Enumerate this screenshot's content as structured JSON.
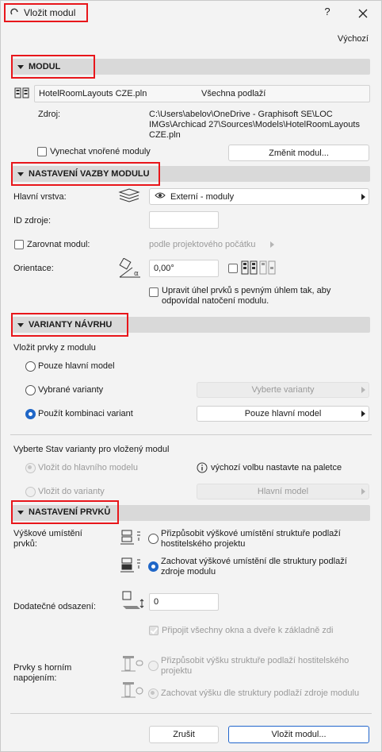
{
  "window": {
    "title": "Vložit modul",
    "help": "?",
    "defaults": "Výchozí"
  },
  "sections": {
    "modul": "MODUL",
    "vazba": "NASTAVENÍ VAZBY MODULU",
    "varianty": "VARIANTY NÁVRHU",
    "prvky": "NASTAVENÍ PRVKŮ"
  },
  "modul": {
    "file_name": "HotelRoomLayouts CZE.pln",
    "floors": "Všechna podlaží",
    "source_label": "Zdroj:",
    "source_line1": "C:\\Users\\abelov\\OneDrive - Graphisoft SE\\LOC",
    "source_line2": "IMGs\\Archicad 27\\Sources\\Models\\HotelRoomLayouts",
    "source_line3": "CZE.pln",
    "skip_nested": "Vynechat vnořené moduly",
    "change_button": "Změnit modul..."
  },
  "vazba": {
    "layer_label": "Hlavní vrstva:",
    "layer_value": "Externí - moduly",
    "source_id_label": "ID zdroje:",
    "source_id_value": "",
    "align_label": "Zarovnat modul:",
    "align_value": "podle projektového počátku",
    "orientation_label": "Orientace:",
    "orientation_value": "0,00°",
    "adjust_angle": "Upravit úhel prvků s pevným úhlem tak, aby odpovídal natočení modulu.",
    "adjust_angle_l1": "Upravit úhel prvků s pevným úhlem tak, aby",
    "adjust_angle_l2": "odpovídal natočení modulu."
  },
  "varianty": {
    "insert_label": "Vložit prvky z modulu",
    "opt_main": "Pouze hlavní model",
    "opt_selected": "Vybrané varianty",
    "opt_selected_btn": "Vyberte varianty",
    "opt_combo": "Použít kombinaci variant",
    "opt_combo_btn": "Pouze hlavní model",
    "state_label": "Vyberte Stav varianty pro vložený modul",
    "insert_main": "Vložit do hlavního modelu",
    "info_text": "výchozí volbu nastavte na paletce",
    "insert_variant": "Vložit do varianty",
    "variant_btn": "Hlavní model"
  },
  "prvky": {
    "height_label_l1": "Výškové umístění",
    "height_label_l2": "prvků:",
    "adapt_l1": "Přizpůsobit výškové umístění struktuře podlaží",
    "adapt_l2": "hostitelského projektu",
    "keep_l1": "Zachovat výškové umístění dle struktury podlaží",
    "keep_l2": "zdroje modulu",
    "offset_label": "Dodatečné odsazení:",
    "offset_value": "0",
    "attach_label": "Připojit všechny okna a dveře k základně zdi",
    "top_label_l1": "Prvky s horním",
    "top_label_l2": "napojením:",
    "top_adapt_l1": "Přizpůsobit výšku struktuře podlaží hostitelského",
    "top_adapt_l2": "projektu",
    "top_keep": "Zachovat výšku dle struktury podlaží zdroje modulu"
  },
  "footer": {
    "cancel": "Zrušit",
    "ok": "Vložit modul..."
  },
  "colors": {
    "accent": "#1f66c7",
    "highlight": "#e8161b",
    "section_bg": "#d9d9d9"
  }
}
